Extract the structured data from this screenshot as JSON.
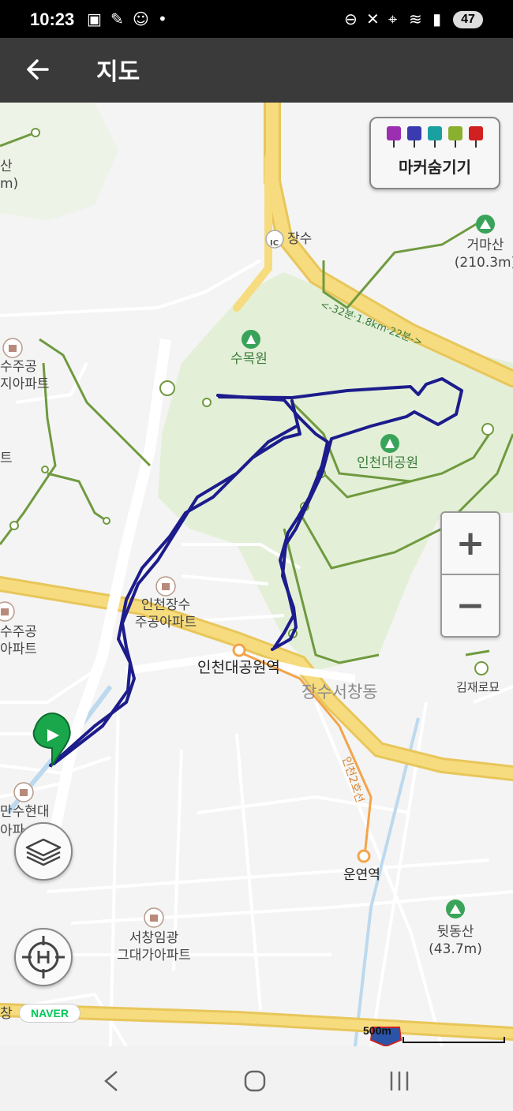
{
  "status_bar": {
    "time": "10:23",
    "battery": "47"
  },
  "app_bar": {
    "title": "지도"
  },
  "marker_panel": {
    "label": "마커숨기기",
    "pin_colors": [
      "#9b2fb0",
      "#3b3bb0",
      "#1aa0a0",
      "#8ab030",
      "#d02020"
    ]
  },
  "map": {
    "labels": {
      "ic_suffix": "장수",
      "ic_badge": "IC",
      "trail_time": "<-32분·1.8km·22분->",
      "sumogwon": "수목원",
      "incheon_park": "인천대공원",
      "geomasan": "거마산",
      "geomasan_height": "(210.3m)",
      "apt_left_top_1": "수주공",
      "apt_left_top_2": "지아파트",
      "left_edge_san_1": "산",
      "left_edge_san_2": "m)",
      "left_edge_teu": "트",
      "apt_janggsu_1": "인천장수",
      "apt_janggsu_2": "주공아파트",
      "apt_left_mid_1": "수주공",
      "apt_left_mid_2": "아파트",
      "station_park": "인천대공원역",
      "area_name": "장수서창동",
      "gimjaero": "김재로묘",
      "line2": "인천2호선",
      "station_unyeon": "운연역",
      "dwitdongsan": "뒷동산",
      "dwitdongsan_height": "(43.7m)",
      "apt_hyundai_1": "만수현대",
      "apt_hyundai_2": "아파",
      "apt_seochang_1": "서창임광",
      "apt_seochang_2": "그대가아파트",
      "bottom_left": "창"
    },
    "naver_logo": "NAVER",
    "scale": "500m",
    "track_color": "#1c1c8c",
    "road_color": "#f1d46a",
    "park_color": "#e4efd8",
    "trail_color": "#6f9a3f"
  },
  "zoom": {
    "in": "+",
    "out": "−"
  }
}
